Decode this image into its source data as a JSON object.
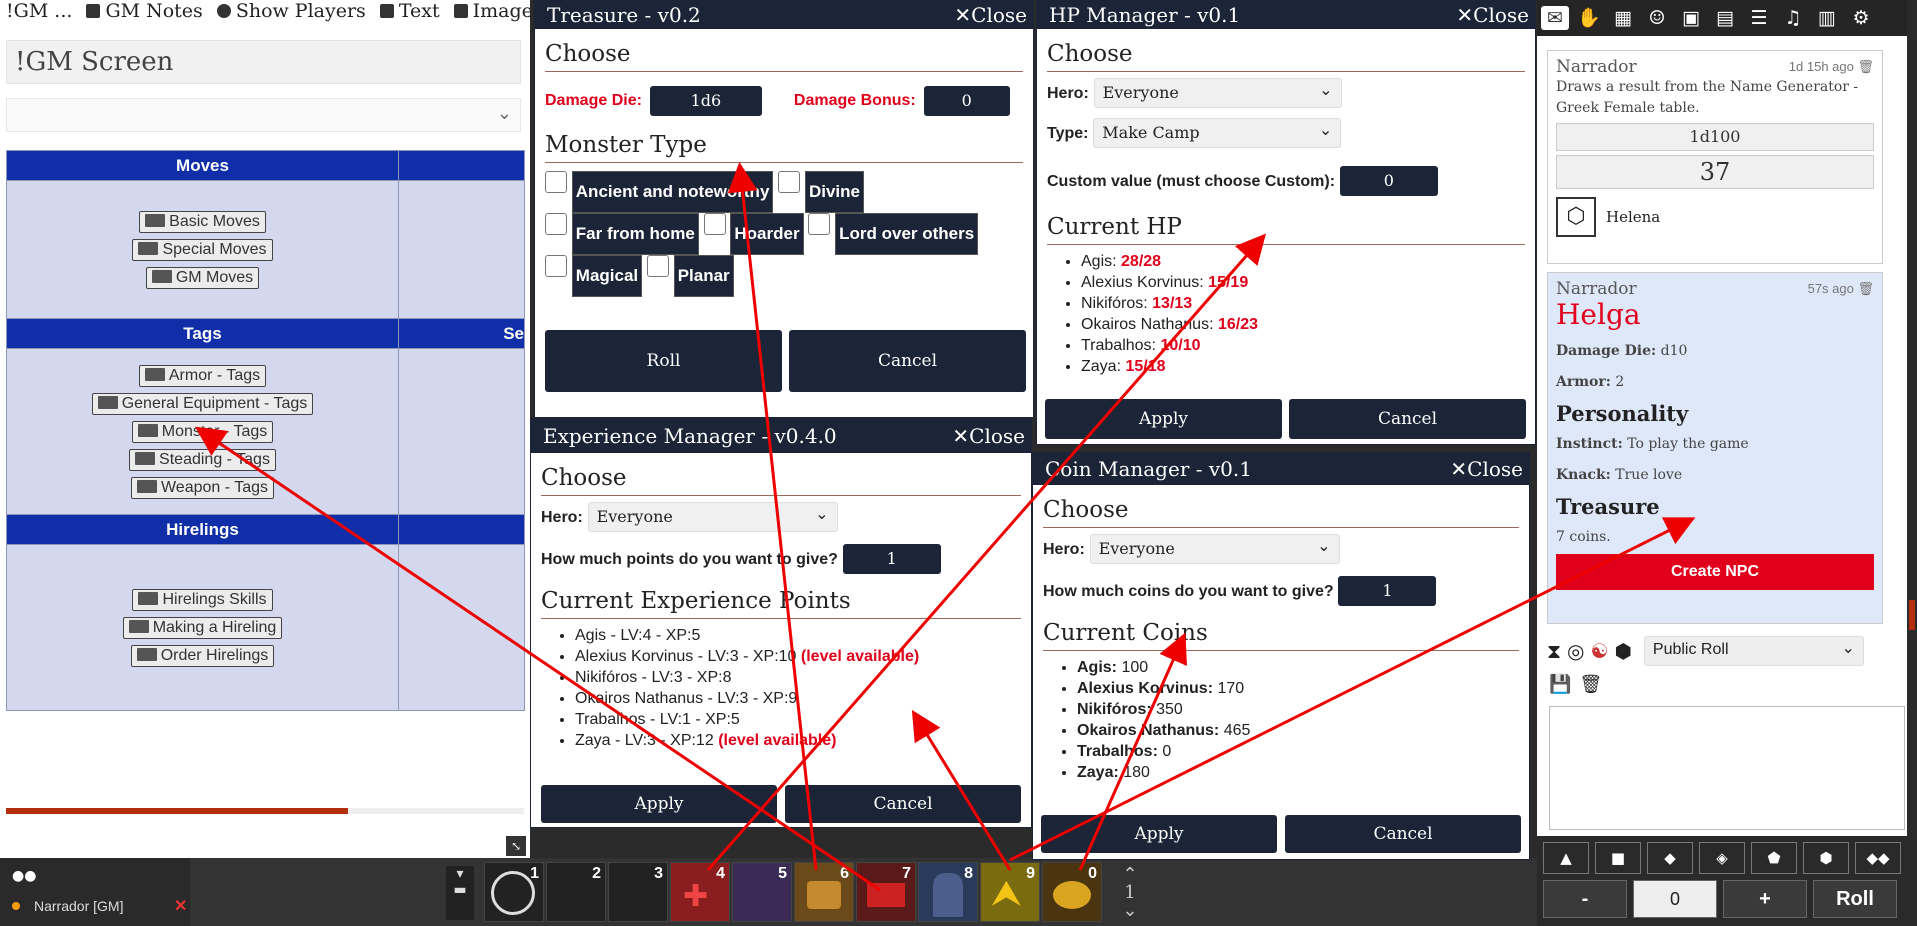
{
  "journal": {
    "toolbar": [
      "!GM ...",
      "GM Notes",
      "Show Players",
      "Text",
      "Image"
    ],
    "title": "!GM Screen",
    "table": {
      "col1": "Moves",
      "moves": [
        "Basic Moves",
        "Special Moves",
        "GM Moves"
      ],
      "tags_header": "Tags",
      "tags_header_right": "Se",
      "tags": [
        "Armor - Tags",
        "General Equipment - Tags",
        "Monster - Tags",
        "Steading - Tags",
        "Weapon - Tags"
      ],
      "hirelings_header": "Hirelings",
      "hirelings": [
        "Hirelings Skills",
        "Making a Hireling",
        "Order Hirelings"
      ]
    }
  },
  "treasure": {
    "title": "Treasure - v0.2",
    "close": "Close",
    "choose": "Choose",
    "damage_die_label": "Damage Die:",
    "damage_die_value": "1d6",
    "damage_bonus_label": "Damage Bonus:",
    "damage_bonus_value": "0",
    "monster_type": "Monster Type",
    "types": [
      "Ancient and noteworthy",
      "Divine",
      "Far from home",
      "Hoarder",
      "Lord over others",
      "Magical",
      "Planar"
    ],
    "roll": "Roll",
    "cancel": "Cancel"
  },
  "hp": {
    "title": "HP Manager - v0.1",
    "close": "Close",
    "choose": "Choose",
    "hero_label": "Hero:",
    "hero_value": "Everyone",
    "type_label": "Type:",
    "type_value": "Make Camp",
    "custom_label": "Custom value (must choose Custom):",
    "custom_value": "0",
    "current": "Current HP",
    "list": [
      {
        "name": "Agis:",
        "val": "28/28"
      },
      {
        "name": "Alexius Korvinus:",
        "val": "15/19"
      },
      {
        "name": "Nikifóros:",
        "val": "13/13"
      },
      {
        "name": "Okairos Nathanus:",
        "val": "16/23"
      },
      {
        "name": "Trabalhos:",
        "val": "10/10"
      },
      {
        "name": "Zaya:",
        "val": "15/18"
      }
    ],
    "apply": "Apply",
    "cancel": "Cancel"
  },
  "xp": {
    "title": "Experience Manager - v0.4.0",
    "close": "Close",
    "choose": "Choose",
    "hero_label": "Hero:",
    "hero_value": "Everyone",
    "points_label": "How much points do you want to give?",
    "points_value": "1",
    "current": "Current Experience Points",
    "list": [
      {
        "text": "Agis - LV:4 - XP:5",
        "extra": ""
      },
      {
        "text": "Alexius Korvinus - LV:3 - XP:10",
        "extra": "(level available)"
      },
      {
        "text": "Nikifóros - LV:3 - XP:8",
        "extra": ""
      },
      {
        "text": "Okairos Nathanus - LV:3 - XP:9",
        "extra": ""
      },
      {
        "text": "Trabalhos - LV:1 - XP:5",
        "extra": ""
      },
      {
        "text": "Zaya - LV:3 - XP:12",
        "extra": "(level available)"
      }
    ],
    "apply": "Apply",
    "cancel": "Cancel"
  },
  "coin": {
    "title": "Coin Manager - v0.1",
    "close": "Close",
    "choose": "Choose",
    "hero_label": "Hero:",
    "hero_value": "Everyone",
    "coins_label": "How much coins do you want to give?",
    "coins_value": "1",
    "current": "Current Coins",
    "list": [
      {
        "name": "Agis:",
        "val": "100"
      },
      {
        "name": "Alexius Korvinus:",
        "val": "170"
      },
      {
        "name": "Nikifóros:",
        "val": "350"
      },
      {
        "name": "Okairos Nathanus:",
        "val": "465"
      },
      {
        "name": "Trabalhos:",
        "val": "0"
      },
      {
        "name": "Zaya:",
        "val": "180"
      }
    ],
    "apply": "Apply",
    "cancel": "Cancel"
  },
  "chat": {
    "msg1": {
      "who": "Narrador",
      "time": "1d 15h ago",
      "desc": "Draws a result from the Name Generator - Greek Female table.",
      "formula": "1d100",
      "result": "37",
      "name": "Helena"
    },
    "msg2": {
      "who": "Narrador",
      "time": "57s ago",
      "npc": "Helga",
      "damage_label": "Damage Die:",
      "damage_value": "d10",
      "armor_label": "Armor:",
      "armor_value": "2",
      "personality": "Personality",
      "instinct_label": "Instinct:",
      "instinct_value": "To play the game",
      "knack_label": "Knack:",
      "knack_value": "True love",
      "treasure": "Treasure",
      "coins": "7 coins.",
      "create": "Create NPC"
    },
    "roll_mode": "Public Roll",
    "counter": "0",
    "minus": "-",
    "plus": "+",
    "roll": "Roll"
  },
  "macrobar": {
    "slots": [
      "1",
      "2",
      "3",
      "4",
      "5",
      "6",
      "7",
      "8",
      "9",
      "0"
    ],
    "page": "1"
  },
  "players": {
    "name": "Narrador [GM]"
  },
  "colors": {
    "navy": "#1b2537",
    "red": "#e0001b",
    "table_header": "#0f2ea8"
  }
}
